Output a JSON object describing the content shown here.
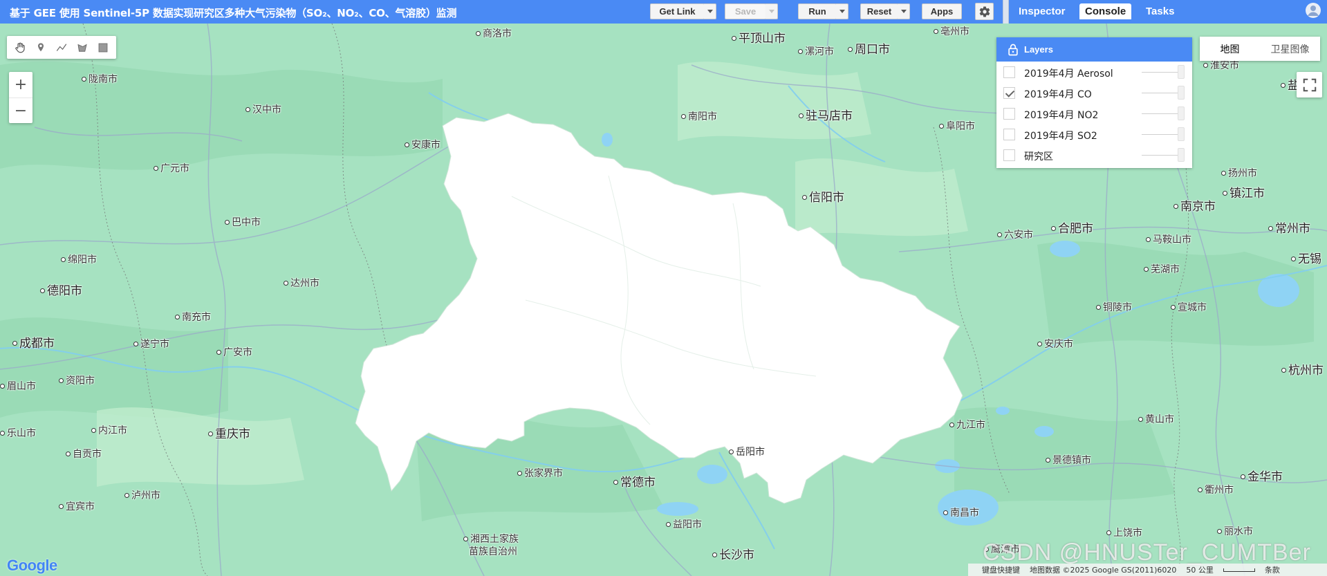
{
  "app": {
    "title": "基于 GEE 使用 Sentinel-5P 数据实现研究区多种大气污染物（SO₂、NO₂、CO、气溶胶）监测"
  },
  "toolbar": {
    "get_link_label": "Get Link",
    "save_label": "Save",
    "run_label": "Run",
    "reset_label": "Reset",
    "apps_label": "Apps"
  },
  "tabs": [
    {
      "label": "Inspector",
      "active": false
    },
    {
      "label": "Console",
      "active": true
    },
    {
      "label": "Tasks",
      "active": false
    }
  ],
  "layers": {
    "title": "Layers",
    "items": [
      {
        "label": "2019年4月 Aerosol",
        "checked": false
      },
      {
        "label": "2019年4月 CO",
        "checked": true
      },
      {
        "label": "2019年4月 NO2",
        "checked": false
      },
      {
        "label": "2019年4月 SO2",
        "checked": false
      },
      {
        "label": "研究区",
        "checked": false
      }
    ]
  },
  "map_type": {
    "map": "地图",
    "satellite": "卫星图像"
  },
  "zoom": {
    "in": "+",
    "out": "−"
  },
  "city_labels": [
    {
      "name": "商洛市",
      "dot": true,
      "big": false
    },
    {
      "name": "平顶山市",
      "dot": true,
      "big": true
    },
    {
      "name": "漯河市",
      "dot": true,
      "big": false
    },
    {
      "name": "周口市",
      "dot": true,
      "big": true
    },
    {
      "name": "亳州市",
      "dot": true,
      "big": false
    },
    {
      "name": "陇南市",
      "dot": true,
      "big": false
    },
    {
      "name": "汉中市",
      "dot": true,
      "big": false
    },
    {
      "name": "南阳市",
      "dot": true,
      "big": false
    },
    {
      "name": "驻马店市",
      "dot": true,
      "big": true
    },
    {
      "name": "阜阳市",
      "dot": true,
      "big": false
    },
    {
      "name": "安康市",
      "dot": true,
      "big": false
    },
    {
      "name": "广元市",
      "dot": true,
      "big": false
    },
    {
      "name": "信阳市",
      "dot": true,
      "big": true
    },
    {
      "name": "巴中市",
      "dot": true,
      "big": false
    },
    {
      "name": "六安市",
      "dot": true,
      "big": false
    },
    {
      "name": "合肥市",
      "dot": true,
      "big": true
    },
    {
      "name": "绵阳市",
      "dot": true,
      "big": false
    },
    {
      "name": "达州市",
      "dot": true,
      "big": false
    },
    {
      "name": "德阳市",
      "dot": true,
      "big": true
    },
    {
      "name": "南充市",
      "dot": true,
      "big": false
    },
    {
      "name": "成都市",
      "dot": true,
      "big": true
    },
    {
      "name": "遂宁市",
      "dot": true,
      "big": false
    },
    {
      "name": "广安市",
      "dot": true,
      "big": false
    },
    {
      "name": "资阳市",
      "dot": true,
      "big": false
    },
    {
      "name": "眉山市",
      "dot": true,
      "big": false
    },
    {
      "name": "重庆市",
      "dot": true,
      "big": true
    },
    {
      "name": "内江市",
      "dot": true,
      "big": false
    },
    {
      "name": "乐山市",
      "dot": true,
      "big": false
    },
    {
      "name": "自贡市",
      "dot": true,
      "big": false
    },
    {
      "name": "泸州市",
      "dot": true,
      "big": false
    },
    {
      "name": "宜宾市",
      "dot": true,
      "big": false
    },
    {
      "name": "张家界市",
      "dot": true,
      "big": false
    },
    {
      "name": "常德市",
      "dot": true,
      "big": true
    },
    {
      "name": "岳阳市",
      "dot": true,
      "big": false
    },
    {
      "name": "九江市",
      "dot": true,
      "big": false
    },
    {
      "name": "益阳市",
      "dot": true,
      "big": false
    },
    {
      "name": "湘西土家族",
      "dot": true,
      "big": false
    },
    {
      "name": "苗族自治州",
      "dot": false,
      "big": false
    },
    {
      "name": "长沙市",
      "dot": true,
      "big": true
    },
    {
      "name": "南昌市",
      "dot": true,
      "big": false
    },
    {
      "name": "景德镇市",
      "dot": true,
      "big": false
    },
    {
      "name": "黄山市",
      "dot": true,
      "big": false
    },
    {
      "name": "安庆市",
      "dot": true,
      "big": false
    },
    {
      "name": "铜陵市",
      "dot": true,
      "big": false
    },
    {
      "name": "宣城市",
      "dot": true,
      "big": false
    },
    {
      "name": "芜湖市",
      "dot": true,
      "big": false
    },
    {
      "name": "马鞍山市",
      "dot": true,
      "big": false
    },
    {
      "name": "南京市",
      "dot": true,
      "big": true
    },
    {
      "name": "镇江市",
      "dot": true,
      "big": true
    },
    {
      "name": "扬州市",
      "dot": true,
      "big": false
    },
    {
      "name": "常州市",
      "dot": true,
      "big": true
    },
    {
      "name": "无锡",
      "dot": true,
      "big": true
    },
    {
      "name": "杭州市",
      "dot": true,
      "big": true
    },
    {
      "name": "金华市",
      "dot": true,
      "big": true
    },
    {
      "name": "衢州市",
      "dot": true,
      "big": false
    },
    {
      "name": "上饶市",
      "dot": true,
      "big": false
    },
    {
      "name": "丽水市",
      "dot": true,
      "big": false
    },
    {
      "name": "鹰潭市",
      "dot": true,
      "big": false
    },
    {
      "name": "淮安市",
      "dot": true,
      "big": false
    },
    {
      "name": "盐",
      "dot": true,
      "big": false
    }
  ],
  "footer": {
    "shortcuts": "键盘快捷键",
    "attribution": "地图数据 ©2025 Google GS(2011)6020",
    "scale": "50 公里",
    "terms": "条款"
  },
  "google_logo": "Google",
  "watermark": "CSDN @HNUSTer_CUMTBer",
  "colors": {
    "header_blue": "#4a8af4",
    "map_green": "#a6e2c1",
    "study_area_fill": "#ffffff",
    "water": "#8fd3f4"
  }
}
